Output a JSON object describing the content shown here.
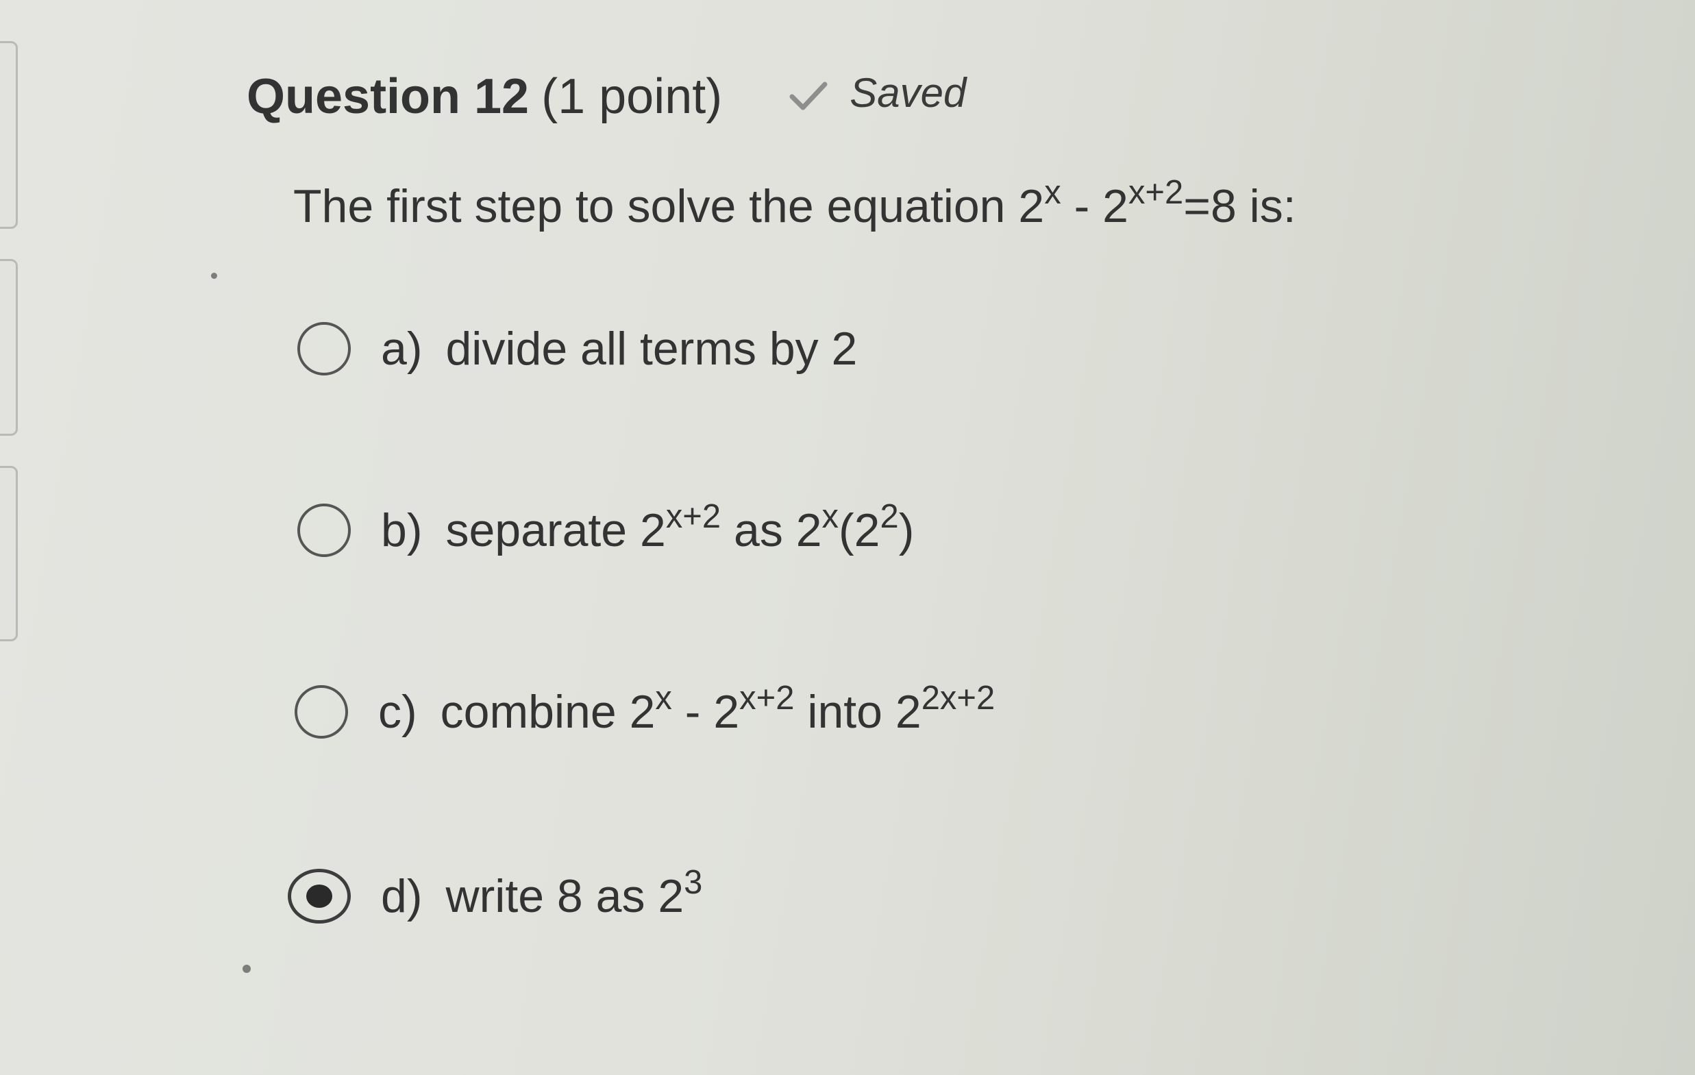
{
  "question": {
    "number_label": "Question 12",
    "points_label": "(1 point)",
    "saved_status": "Saved",
    "prompt": {
      "text_before": "The first step to solve the equation 2",
      "exp1": "x",
      "minus": " - 2",
      "exp2": "x+2",
      "text_after": "=8 is:"
    }
  },
  "options": [
    {
      "letter": "a)",
      "label": "divide all terms by 2",
      "checked": false
    },
    {
      "letter": "b)",
      "before": "separate 2",
      "exp1": "x+2",
      "mid": " as 2",
      "exp2": "x",
      "mid2": "(2",
      "exp3": "2",
      "after": ")",
      "checked": false
    },
    {
      "letter": "c)",
      "before": "combine 2",
      "exp1": "x",
      "mid": " - 2",
      "exp2": "x+2",
      "mid2": " into 2",
      "exp3": "2x+2",
      "checked": false
    },
    {
      "letter": "d)",
      "before": "write 8 as 2",
      "exp1": "3",
      "checked": true
    }
  ],
  "colors": {
    "text": "#333333",
    "radio_border": "#555555",
    "background": "#e1e2dc"
  },
  "icons": {
    "saved": "check-icon",
    "radio": "radio-circle-icon"
  }
}
